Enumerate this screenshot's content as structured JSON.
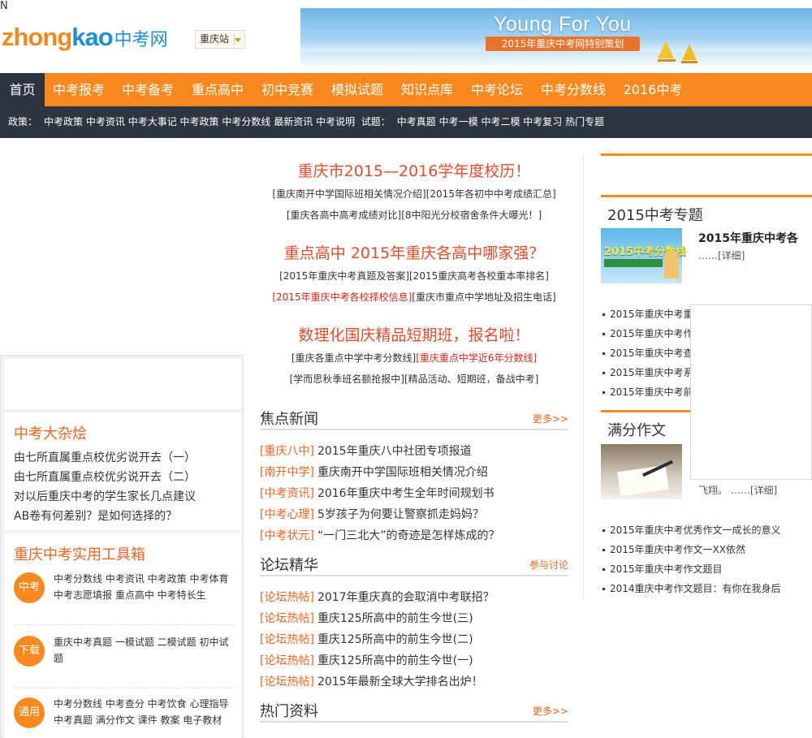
{
  "header": {
    "logo_en_part1": "zhong",
    "logo_en_part2": "kao",
    "logo_cn": "中考网",
    "station": "重庆站",
    "banner_title": "Young For You",
    "banner_subtitle": "2015年重庆中考网特别策划"
  },
  "nav": {
    "items": [
      "首页",
      "中考报考",
      "中考备考",
      "重点高中",
      "初中竞赛",
      "模拟试题",
      "知识点库",
      "中考论坛",
      "中考分数线",
      "2016中考"
    ],
    "new_badge": "N"
  },
  "subnav": {
    "label1": "政策：",
    "group1": [
      "中考政策",
      "中考资讯",
      "中考大事记",
      "中考政策",
      "中考分数线",
      "最新资讯",
      "中考说明"
    ],
    "label2": "试题：",
    "group2": [
      "中考真题",
      "中考一模",
      "中考二模",
      "中考复习",
      "热门专题"
    ]
  },
  "center": {
    "headline1": "重庆市2015—2016学年度校历！",
    "sub1a": "[重庆南开中学国际班相关情况介绍]",
    "sub1b": "[2015年各初中中考成绩汇总]",
    "sub1c": "[重庆各高中高考成绩对比]",
    "sub1d": "[8中阳光分校宿舍条件大曝光！]",
    "headline2": "重点高中 2015年重庆各高中哪家强？",
    "sub2a": "[2015年重庆中考真题及答案]",
    "sub2b": "[2015重庆高考各校重本率排名]",
    "sub2c": "[2015年重庆中考各校择校信息]",
    "sub2d": "[重庆市重点中学地址及招生电话]",
    "headline3": "数理化国庆精品短期班，报名啦！",
    "sub3a": "[重庆各重点中学中考分数线]",
    "sub3b": "[重庆重点中学近6年分数线]",
    "sub3c": "[学而思秋季班名额抢报中]",
    "sub3d": "[精品活动、短期班，备战中考]",
    "focus": {
      "title": "焦点新闻",
      "more": "更多>>",
      "items": [
        {
          "tag": "[重庆八中]",
          "text": "2015年重庆八中社团专项报道"
        },
        {
          "tag": "[南开中学]",
          "text": "重庆南开中学国际班相关情况介绍"
        },
        {
          "tag": "[中考资讯]",
          "text": "2016年重庆中考生全年时间规划书"
        },
        {
          "tag": "[中考心理]",
          "text": "5岁孩子为何要让警察抓走妈妈？"
        },
        {
          "tag": "[中考状元]",
          "text": "“一门三北大”的奇迹是怎样炼成的？"
        }
      ]
    },
    "forum": {
      "title": "论坛精华",
      "more": "参与讨论",
      "items": [
        {
          "tag": "[论坛热帖]",
          "text": "2017年重庆真的会取消中考联招？"
        },
        {
          "tag": "[论坛热帖]",
          "text": "重庆125所高中的前生今世(三)"
        },
        {
          "tag": "[论坛热帖]",
          "text": "重庆125所高中的前生今世(二)"
        },
        {
          "tag": "[论坛热帖]",
          "text": "重庆125所高中的前生今世(一)"
        },
        {
          "tag": "[论坛热帖]",
          "text": "2015年最新全球大学排名出炉！"
        }
      ]
    },
    "hot": {
      "title": "热门资料",
      "more": "更多>>"
    }
  },
  "left": {
    "magazine_title": "中考大杂烩",
    "magazine_items": [
      "由七所直属重点校优劣说开去（一）",
      "由七所直属重点校优劣说开去（二）",
      "对以后重庆中考的学生家长几点建议",
      "AB卷有何差别？是如何选择的？"
    ],
    "tools_title": "重庆中考实用工具箱",
    "tools": [
      {
        "badge": "中考",
        "links": "中考分数线 中考资讯 中考政策 中考体育 中考志愿填报 重点高中 中考特长生"
      },
      {
        "badge": "下载",
        "links": "重庆中考真题 一模试题 二模试题 初中试题"
      },
      {
        "badge": "通用",
        "links": "中考分数线 中考查分 中考饮食 心理指导 中考真题 满分作文 课件 教案 电子教材"
      }
    ]
  },
  "right": {
    "topic_title": "2015中考专题",
    "topic_feature_title": "2015年重庆中考各",
    "topic_feature_detail": "……[详细]",
    "topic_list": [
      "2015年重庆中考重",
      "2015年重庆中考作文",
      "2015年重庆中考查分",
      "2015年重庆中考系列",
      "2015年重庆中考前"
    ],
    "essay_title": "满分作文",
    "essay_feature_detail": "飞翔。 ……[详细]",
    "essay_list": [
      "2015年重庆中考优秀作文一成长的意义",
      "2015年重庆中考作文一XX依然",
      "2015年重庆中考作文题目",
      "2014重庆中考作文题目：有你在我身后"
    ],
    "thumb1_text": "2015中考分数线"
  },
  "colors": {
    "brand_orange": "#f7891f",
    "nav_dark": "#2d3540",
    "headline_red": "#e34b2d",
    "logo_blue": "#1f8fd6"
  }
}
